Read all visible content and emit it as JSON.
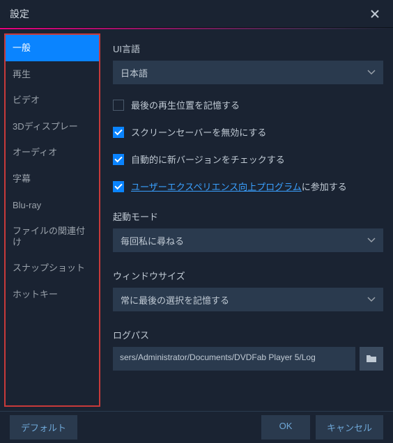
{
  "window_title": "設定",
  "sidebar": {
    "items": [
      {
        "label": "一般",
        "active": true
      },
      {
        "label": "再生",
        "active": false
      },
      {
        "label": "ビデオ",
        "active": false
      },
      {
        "label": "3Dディスプレー",
        "active": false
      },
      {
        "label": "オーディオ",
        "active": false
      },
      {
        "label": "字幕",
        "active": false
      },
      {
        "label": "Blu-ray",
        "active": false
      },
      {
        "label": "ファイルの関連付け",
        "active": false
      },
      {
        "label": "スナップショット",
        "active": false
      },
      {
        "label": "ホットキー",
        "active": false
      }
    ]
  },
  "main": {
    "ui_language_label": "UI言語",
    "ui_language_value": "日本語",
    "remember_position_label": "最後の再生位置を記憶する",
    "remember_position_checked": false,
    "disable_screensaver_label": "スクリーンセーバーを無効にする",
    "disable_screensaver_checked": true,
    "auto_update_label": "自動的に新バージョンをチェックする",
    "auto_update_checked": true,
    "ux_program_link": "ユーザーエクスペリエンス向上プログラム",
    "ux_program_suffix": "に参加する",
    "ux_program_checked": true,
    "startup_mode_label": "起動モード",
    "startup_mode_value": "毎回私に尋ねる",
    "window_size_label": "ウィンドウサイズ",
    "window_size_value": "常に最後の選択を記憶する",
    "log_path_label": "ログパス",
    "log_path_value": "sers/Administrator/Documents/DVDFab Player 5/Log"
  },
  "footer": {
    "default_label": "デフォルト",
    "ok_label": "OK",
    "cancel_label": "キャンセル"
  },
  "colors": {
    "accent": "#0a84ff",
    "highlight_border": "#c83a3a"
  }
}
